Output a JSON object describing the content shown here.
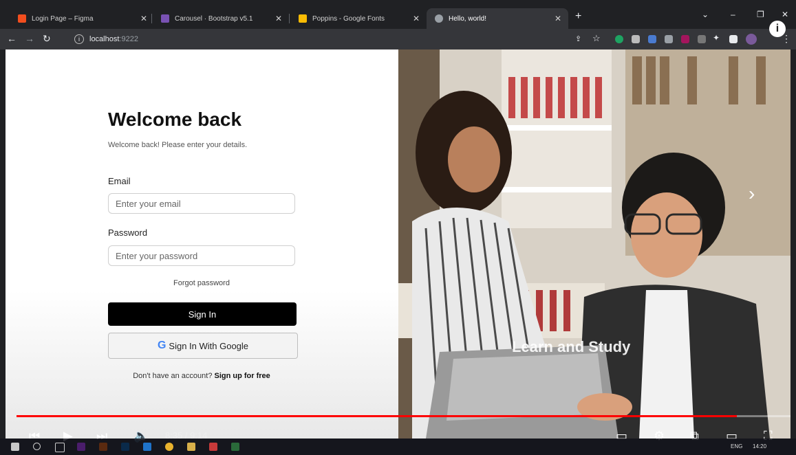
{
  "browser": {
    "tabs": [
      {
        "title": "Login Page – Figma",
        "icon": "figma-icon",
        "color": "#f24e1e"
      },
      {
        "title": "Carousel · Bootstrap v5.1",
        "icon": "bootstrap-icon",
        "color": "#7952b3"
      },
      {
        "title": "Poppins - Google Fonts",
        "icon": "google-fonts-icon",
        "color": "#fbbc04"
      },
      {
        "title": "Hello, world!",
        "icon": "globe-icon",
        "color": "#9aa0a6"
      }
    ],
    "active_tab": 3,
    "url_host": "localhost",
    "url_port": ":9222"
  },
  "login": {
    "title": "Welcome back",
    "subtitle": "Welcome back! Please enter your details.",
    "email_label": "Email",
    "email_placeholder": "Enter your email",
    "password_label": "Password",
    "password_placeholder": "Enter your password",
    "forgot": "Forgot password",
    "signin": "Sign In",
    "google": "Sign In With Google",
    "google_g": "G",
    "no_account": "Don't have an account?",
    "signup": "Sign up for free"
  },
  "carousel": {
    "caption": "Learn and Study",
    "next": "›"
  },
  "video": {
    "time": "8:35 / 9:14",
    "progress": 0.931
  },
  "taskbar": {
    "lang": "ENG",
    "clock": "14:20"
  },
  "colors": {
    "accent": "#ff0000",
    "button": "#000000"
  }
}
